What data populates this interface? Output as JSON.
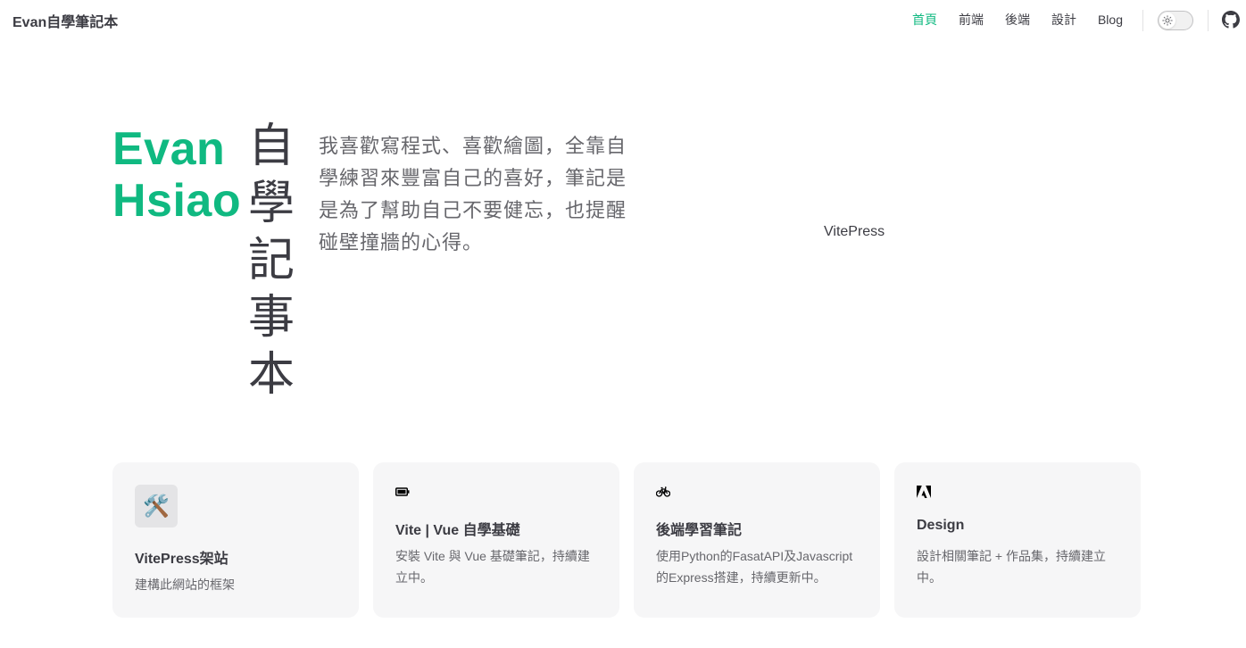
{
  "nav": {
    "site_title": "Evan自學筆記本",
    "links": [
      {
        "label": "首頁",
        "active": true
      },
      {
        "label": "前端",
        "active": false
      },
      {
        "label": "後端",
        "active": false
      },
      {
        "label": "設計",
        "active": false
      },
      {
        "label": "Blog",
        "active": false
      }
    ],
    "theme_toggle_icon": "sun-icon",
    "social_icon": "github-icon"
  },
  "hero": {
    "name_line1": "Evan",
    "name_line2": "Hsiao",
    "text": "自學記事本",
    "tagline": "我喜歡寫程式、喜歡繪圖，全靠自學練習來豐富自己的喜好，筆記是是為了幫助自己不要健忘，也提醒碰壁撞牆的心得。",
    "image_alt": "VitePress"
  },
  "features": [
    {
      "icon": "🛠️",
      "icon_name": "tools-icon",
      "title": "VitePress架站",
      "details": "建構此網站的框架"
    },
    {
      "icon": "battery-icon",
      "title": "Vite | Vue 自學基礎",
      "details": "安裝 Vite 與 Vue 基礎筆記，持續建立中。"
    },
    {
      "icon": "bicycle-icon",
      "title": "後端學習筆記",
      "details": "使用Python的FasatAPI及Javascript的Express搭建，持續更新中。"
    },
    {
      "icon": "adobe-icon",
      "title": "Design",
      "details": "設計相關筆記 + 作品集，持續建立中。"
    }
  ],
  "colors": {
    "brand": "#10b981",
    "text": "#3c3c43",
    "muted": "#67676c",
    "card_bg": "#f6f6f7"
  }
}
